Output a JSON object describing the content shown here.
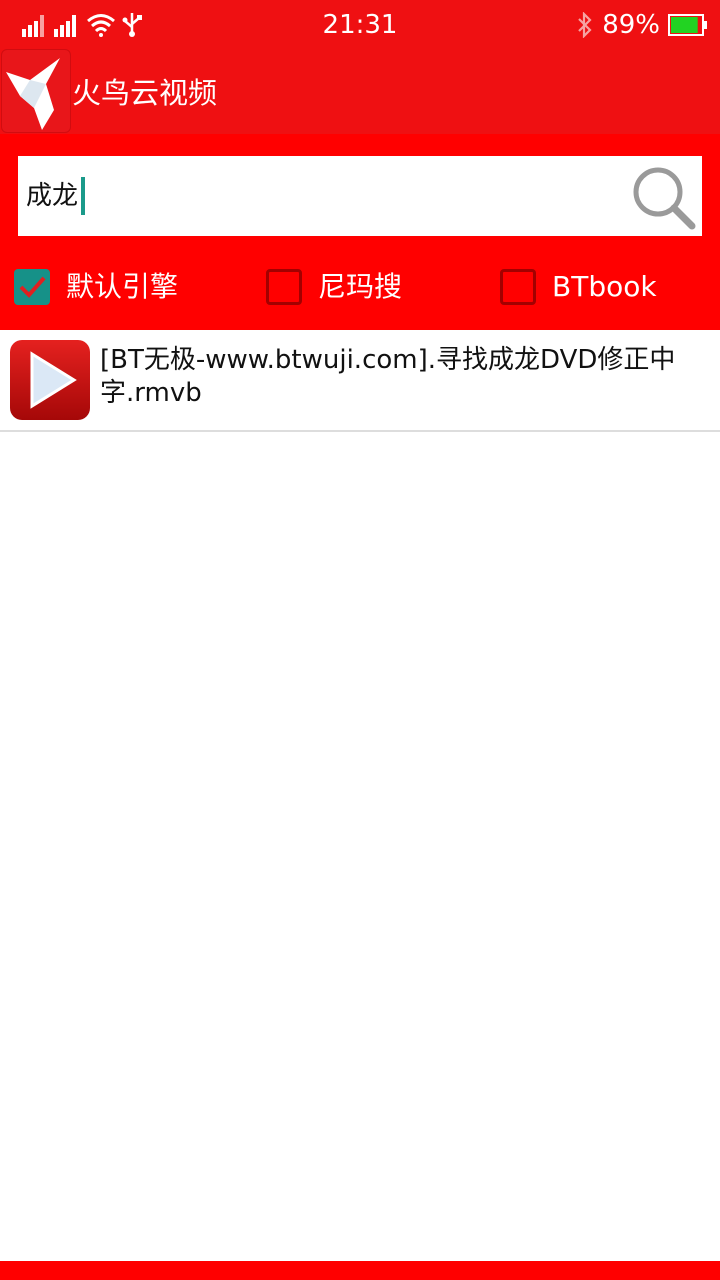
{
  "status_bar": {
    "time": "21:31",
    "battery_percent": "89%",
    "battery_level": 0.89,
    "icons": [
      "signal-icon",
      "signal-icon",
      "wifi-icon",
      "usb-icon",
      "bluetooth-icon",
      "battery-icon"
    ]
  },
  "app_bar": {
    "title": "火鸟云视频",
    "logo_icon": "hummingbird-logo-icon"
  },
  "search": {
    "value": "成龙",
    "button_icon": "search-icon"
  },
  "engines": [
    {
      "label": "默认引擎",
      "checked": true
    },
    {
      "label": "尼玛搜",
      "checked": false
    },
    {
      "label": "BTbook",
      "checked": false
    }
  ],
  "results": [
    {
      "title": "[BT无极-www.btwuji.com].寻找成龙DVD修正中字.rmvb",
      "icon": "play-video-icon"
    }
  ],
  "colors": {
    "primary_red": "#ef1012",
    "panel_red": "#ff0000",
    "check_teal": "#169188"
  }
}
